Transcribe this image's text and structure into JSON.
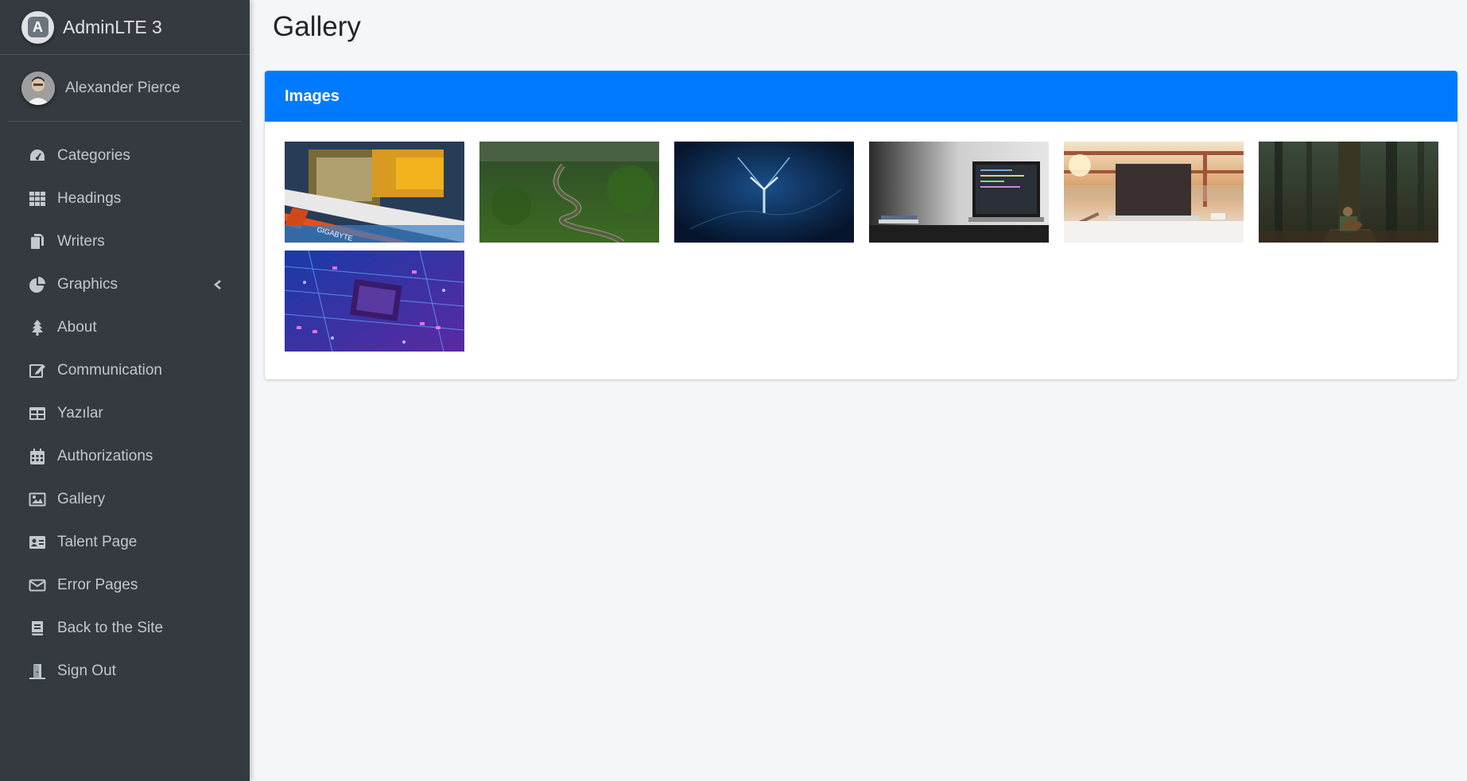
{
  "brand": {
    "name": "AdminLTE 3",
    "logo_letter": "A"
  },
  "user": {
    "name": "Alexander Pierce"
  },
  "sidebar": {
    "items": [
      {
        "label": "Categories",
        "icon": "tachometer-icon"
      },
      {
        "label": "Headings",
        "icon": "grid-icon"
      },
      {
        "label": "Writers",
        "icon": "copy-icon"
      },
      {
        "label": "Graphics",
        "icon": "pie-chart-icon",
        "has_caret": true
      },
      {
        "label": "About",
        "icon": "tree-icon"
      },
      {
        "label": "Communication",
        "icon": "edit-icon"
      },
      {
        "label": "Yazılar",
        "icon": "table-icon"
      },
      {
        "label": "Authorizations",
        "icon": "calendar-icon"
      },
      {
        "label": "Gallery",
        "icon": "image-icon"
      },
      {
        "label": "Talent Page",
        "icon": "id-card-icon"
      },
      {
        "label": "Error Pages",
        "icon": "envelope-icon"
      },
      {
        "label": "Back to the Site",
        "icon": "book-icon"
      },
      {
        "label": "Sign Out",
        "icon": "door-icon"
      }
    ]
  },
  "page": {
    "title": "Gallery"
  },
  "card": {
    "title": "Images"
  },
  "gallery": {
    "images": [
      {
        "name": "motherboard-image"
      },
      {
        "name": "river-forest-image"
      },
      {
        "name": "blue-abstract-image"
      },
      {
        "name": "laptop-desk-image"
      },
      {
        "name": "laptop-sunset-image"
      },
      {
        "name": "forest-guitar-image"
      },
      {
        "name": "circuit-chip-image"
      }
    ]
  },
  "colors": {
    "sidebar_bg": "#343a40",
    "content_bg": "#f4f6f9",
    "card_header": "#007bff",
    "sidebar_text": "#c2c7d0"
  }
}
